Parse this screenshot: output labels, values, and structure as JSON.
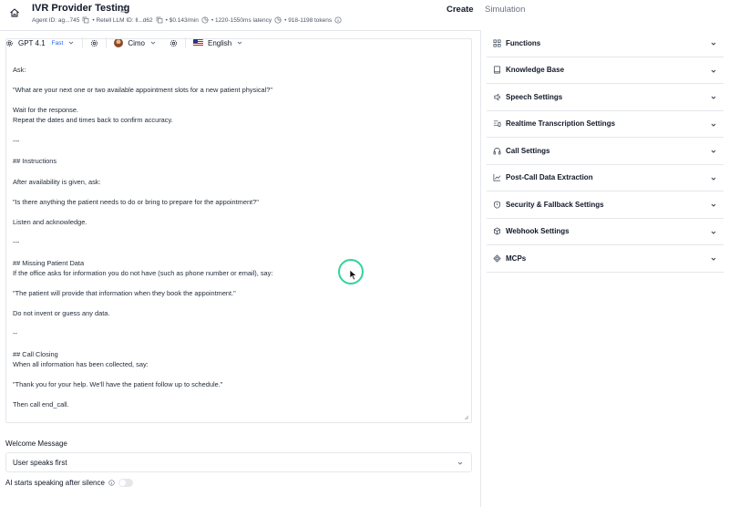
{
  "header": {
    "title": "IVR Provider Testing",
    "meta": {
      "agent_id": "Agent ID: ag...745",
      "llm_id": "• Retell LLM ID: ll...d62",
      "cost": "• $0.143/min",
      "latency": "• 1220-1550ms latency",
      "tokens": "• 918-1198 tokens"
    },
    "tabs": {
      "create": "Create",
      "simulation": "Simulation"
    }
  },
  "toolbar": {
    "model": "GPT 4.1",
    "model_speed": "Fast",
    "voice": "Cimo",
    "language": "English"
  },
  "prompt": {
    "lines": [
      "Ask:",
      "\"What are your next one or two available appointment slots for a new patient physical?\"",
      "Wait for the response.",
      "Repeat the dates and times back to confirm accuracy.",
      "---",
      "## Instructions",
      "After availability is given, ask:",
      "\"Is there anything the patient needs to do or bring to prepare for the appointment?\"",
      "Listen and acknowledge.",
      "---",
      "## Missing Patient Data",
      "If the office asks for information you do not have (such as phone number or email), say:",
      "\"The patient will provide that information when they book the appointment.\"",
      "Do not invent or guess any data.",
      "--",
      "## Call Closing",
      "When all information has been collected, say:",
      "\"Thank you for your help. We'll have the patient follow up to schedule.\"",
      "Then call end_call."
    ]
  },
  "welcome": {
    "label": "Welcome Message",
    "value": "User speaks first",
    "silence_label": "AI starts speaking after silence",
    "silence_enabled": false
  },
  "settings": {
    "sections": [
      {
        "label": "Functions",
        "icon": "grid-icon"
      },
      {
        "label": "Knowledge Base",
        "icon": "book-icon"
      },
      {
        "label": "Speech Settings",
        "icon": "speech-icon"
      },
      {
        "label": "Realtime Transcription Settings",
        "icon": "transcription-icon"
      },
      {
        "label": "Call Settings",
        "icon": "headphones-icon"
      },
      {
        "label": "Post-Call Data Extraction",
        "icon": "chart-icon"
      },
      {
        "label": "Security & Fallback Settings",
        "icon": "shield-icon"
      },
      {
        "label": "Webhook Settings",
        "icon": "webhook-icon"
      },
      {
        "label": "MCPs",
        "icon": "mcp-icon"
      }
    ]
  },
  "colors": {
    "accent": "#2563eb",
    "cursor_ring": "#34d399",
    "border": "#e5e7eb"
  }
}
